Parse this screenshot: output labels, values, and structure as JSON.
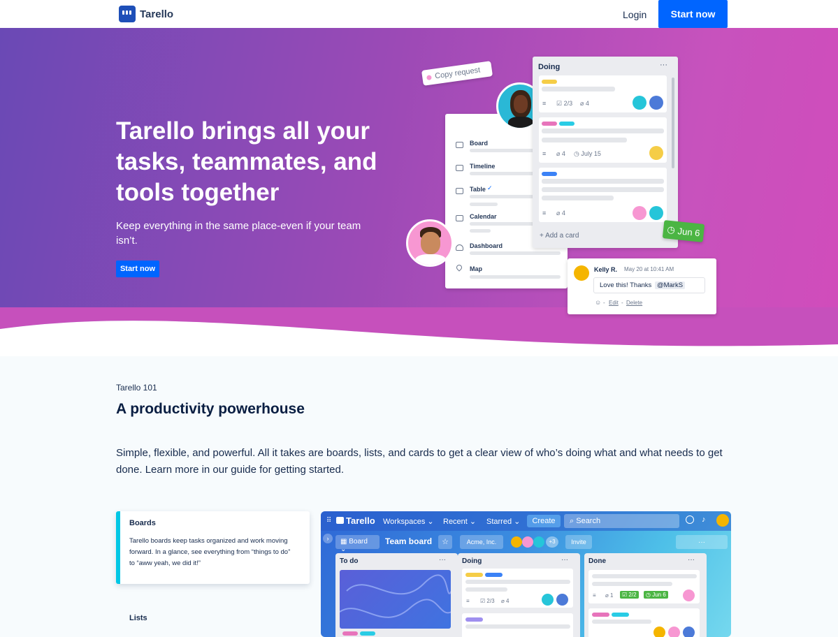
{
  "brand": {
    "name": "Tarello"
  },
  "nav": {
    "login": "Login",
    "start": "Start now"
  },
  "hero": {
    "title": "Tarello brings all your tasks, teammates, and tools together",
    "subtitle": "Keep everything in the same place-even if your team isn’t.",
    "cta": "Start now"
  },
  "illustration": {
    "copy_request": "Copy request",
    "views": [
      "Board",
      "Timeline",
      "Table",
      "Calendar",
      "Dashboard",
      "Map"
    ],
    "doing_list": {
      "title": "Doing",
      "menu": "···",
      "card1_checklist": "2/3",
      "card1_attach": "4",
      "card2_attach": "4",
      "card2_date": "July 15",
      "card3_attach": "4",
      "add_card": "Add a card"
    },
    "date_badge": "Jun 6",
    "comment": {
      "author": "Kelly R.",
      "time": "May 20 at 10:41 AM",
      "text": "Love this! Thanks",
      "mention": "@MarkS",
      "edit": "Edit",
      "delete": "Delete",
      "sep": "-"
    }
  },
  "section": {
    "tag": "Tarello 101",
    "title": "A productivity powerhouse",
    "body": "Simple, flexible, and powerful. All it takes are boards, lists, and cards to get a clear view of who’s doing what and what needs to get done. Learn more in our guide for getting started."
  },
  "features": [
    {
      "title": "Boards",
      "text": "Tarello boards keep tasks organized and work moving forward. In a glance, see everything from “things to do” to “aww yeah, we did it!”"
    },
    {
      "title": "Lists"
    }
  ],
  "app": {
    "brand": "Tarello",
    "nav": [
      "Workspaces",
      "Recent",
      "Starred"
    ],
    "create": "Create",
    "search": "Search",
    "board_btn": "Board",
    "board_title": "Team board",
    "workspace": "Acme, Inc.",
    "member_more": "+3",
    "invite": "Invite",
    "more": "···",
    "columns": [
      {
        "title": "To do"
      },
      {
        "title": "Doing",
        "checklist": "2/3",
        "attach": "4"
      },
      {
        "title": "Done",
        "attach": "1",
        "checklist": "2/2",
        "date": "Jun 6"
      }
    ]
  },
  "colors": {
    "primary": "#0065ff",
    "hero_start": "#6a49b5",
    "hero_end": "#d14cbb",
    "accent_cyan": "#00c7e5",
    "green": "#4bb543"
  }
}
